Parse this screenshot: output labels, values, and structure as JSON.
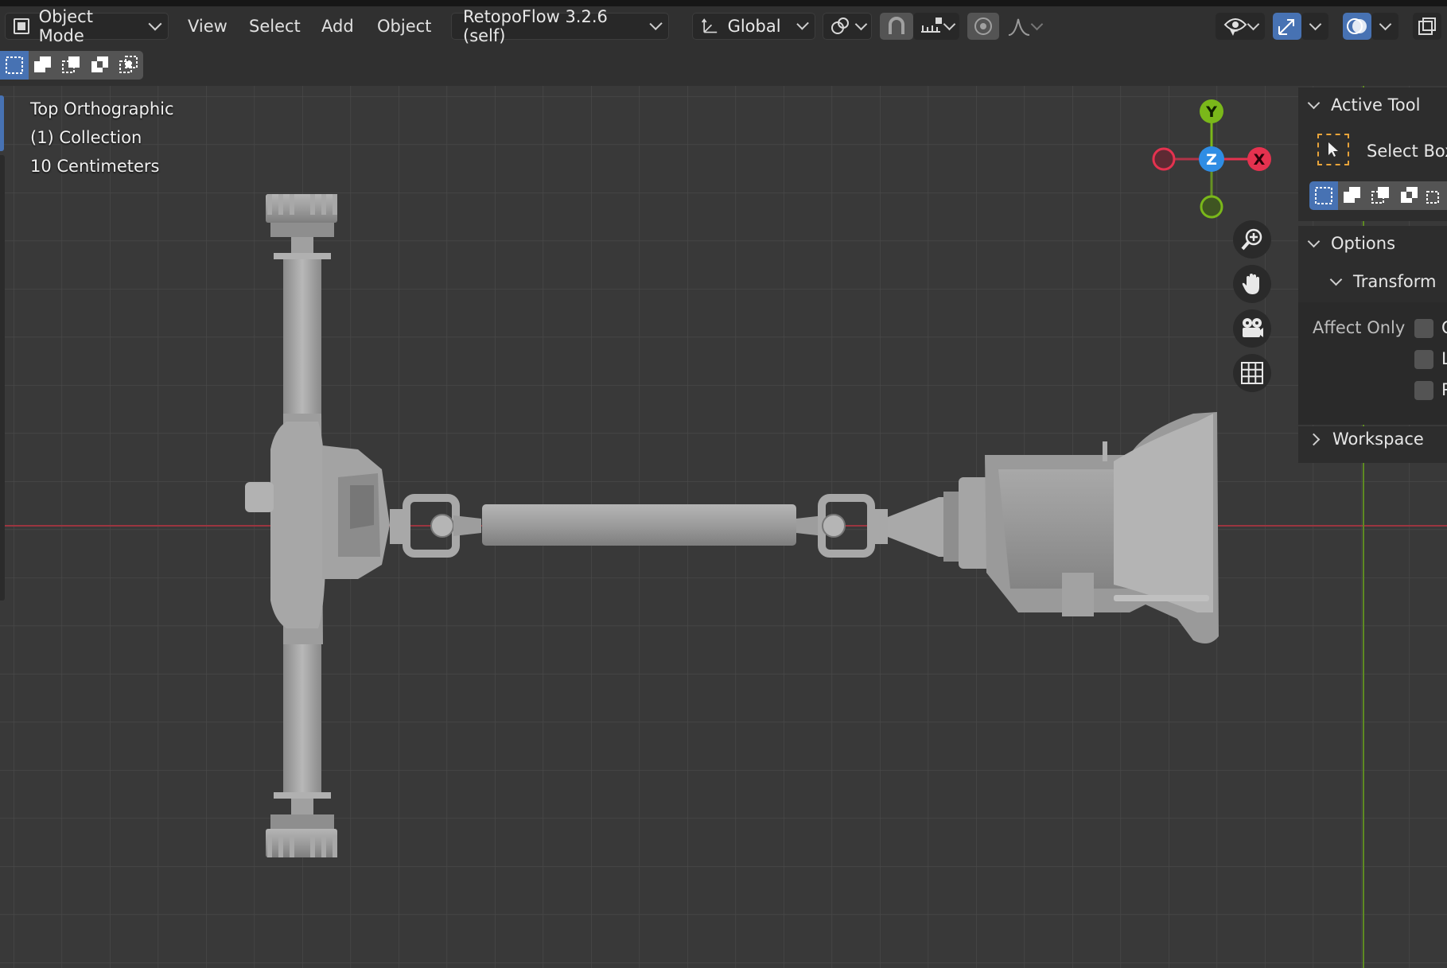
{
  "header": {
    "mode_label": "Object Mode",
    "menus": [
      "View",
      "Select",
      "Add",
      "Object"
    ],
    "addon_label": "RetopoFlow 3.2.6 (self)",
    "orientation_label": "Global"
  },
  "viewport": {
    "view_name": "Top Orthographic",
    "collection": "(1) Collection",
    "grid_scale": "10 Centimeters"
  },
  "gizmo": {
    "axis_y": "Y",
    "axis_z": "Z",
    "axis_x": "X",
    "colors": {
      "x": "#e5324f",
      "y": "#7ab81a",
      "z": "#2f8de4",
      "accent": "#4772b3"
    }
  },
  "nav_icons": [
    "zoom-icon",
    "hand-icon",
    "camera-icon",
    "grid-icon"
  ],
  "npanel": {
    "active_tool_title": "Active Tool",
    "active_tool_name": "Select Box",
    "options_title": "Options",
    "transform_title": "Transform",
    "affect_only_label": "Affect Only",
    "affect_only_options": [
      "O",
      "L",
      "P"
    ],
    "workspace_title": "Workspace"
  }
}
